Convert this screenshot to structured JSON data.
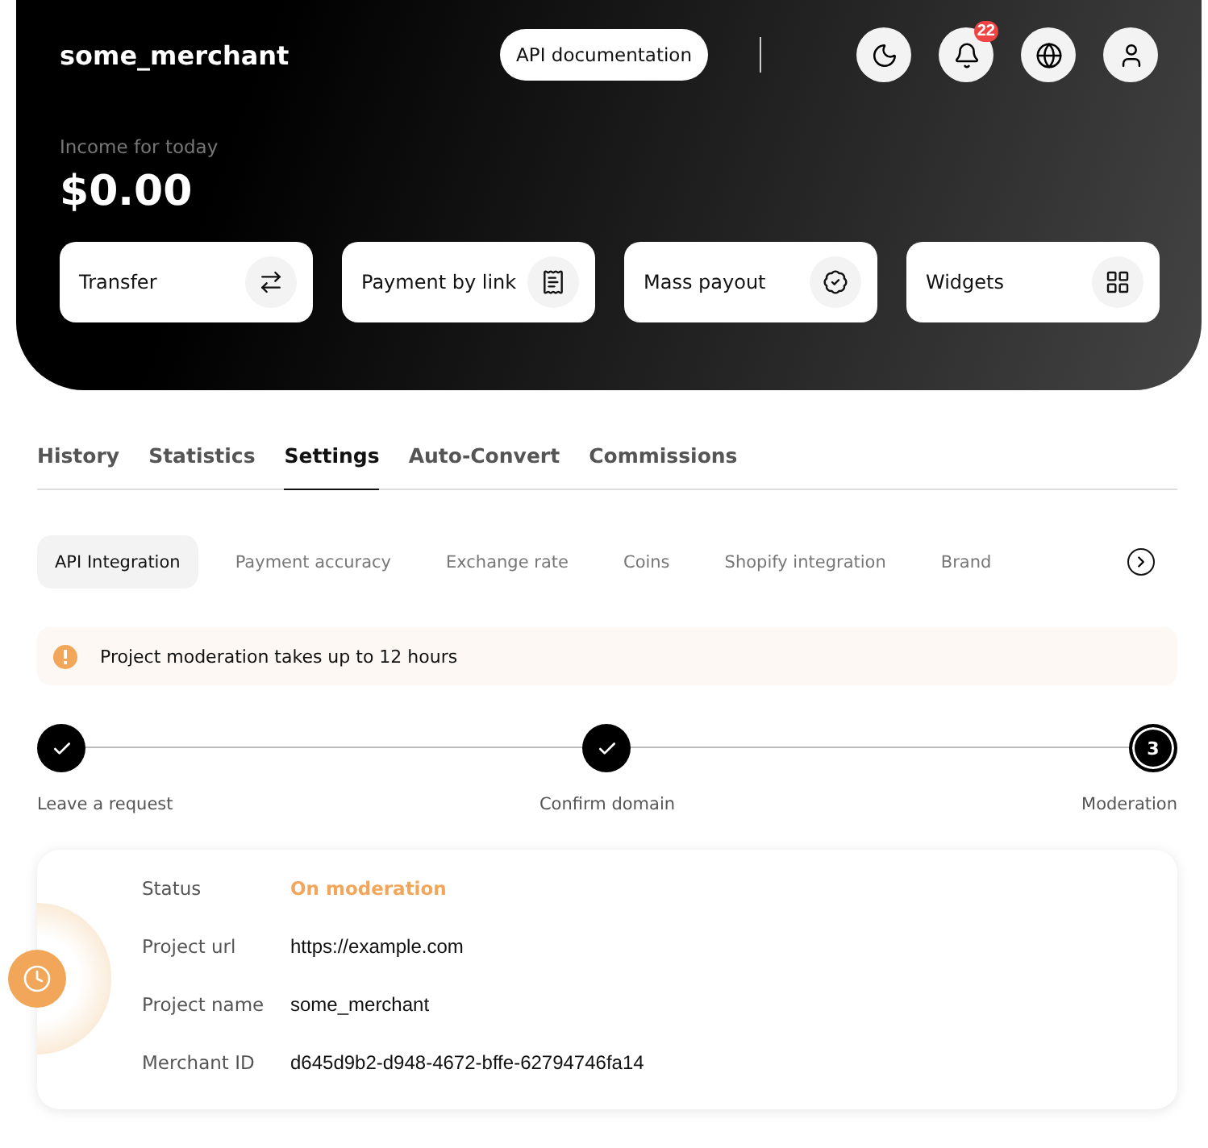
{
  "header": {
    "merchant": "some_merchant",
    "docs_button": "API documentation",
    "notifications_count": "22",
    "income_label": "Income for today",
    "income": "$0.00"
  },
  "actions": [
    {
      "label": "Transfer",
      "kind": "transfer"
    },
    {
      "label": "Payment by link",
      "kind": "receipt"
    },
    {
      "label": "Mass payout",
      "kind": "payout"
    },
    {
      "label": "Widgets",
      "kind": "widgets"
    }
  ],
  "tabs": [
    {
      "label": "History",
      "selected": false
    },
    {
      "label": "Statistics",
      "selected": false
    },
    {
      "label": "Settings",
      "selected": true
    },
    {
      "label": "Auto-Convert",
      "selected": false
    },
    {
      "label": "Commissions",
      "selected": false
    }
  ],
  "subtabs": [
    {
      "label": "API Integration",
      "selected": true
    },
    {
      "label": "Payment accuracy",
      "selected": false
    },
    {
      "label": "Exchange rate",
      "selected": false
    },
    {
      "label": "Coins",
      "selected": false
    },
    {
      "label": "Shopify integration",
      "selected": false
    },
    {
      "label": "Brand",
      "selected": false
    }
  ],
  "alert": "Project moderation takes up to 12 hours",
  "steps": [
    {
      "label": "Leave a request",
      "kind": "done"
    },
    {
      "label": "Confirm domain",
      "kind": "done"
    },
    {
      "label": "Moderation",
      "kind": "current",
      "number": "3"
    }
  ],
  "details": [
    {
      "label": "Status",
      "value": "On moderation",
      "kind": "status"
    },
    {
      "label": "Project url",
      "value": "https://example.com",
      "kind": "plain"
    },
    {
      "label": "Project name",
      "value": "some_merchant",
      "kind": "plain"
    },
    {
      "label": "Merchant ID",
      "value": "d645d9b2-d948-4672-bffe-62794746fa14",
      "kind": "plain"
    }
  ]
}
